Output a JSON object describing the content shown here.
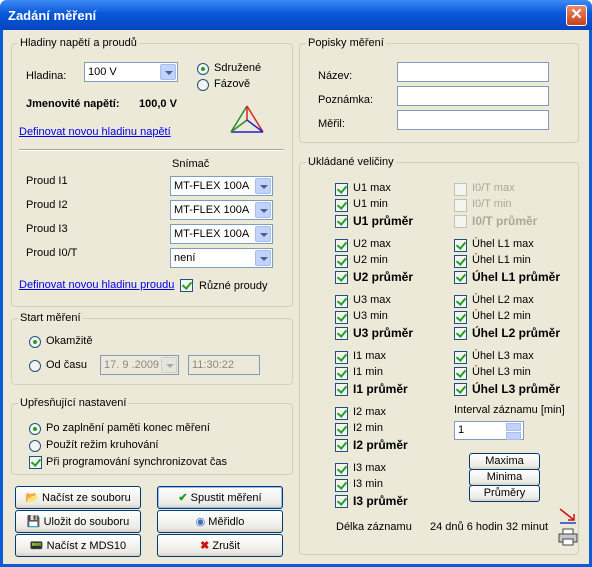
{
  "window": {
    "title": "Zadání měření",
    "close": "✕"
  },
  "levels": {
    "legend": "Hladiny napětí a proudů",
    "hladina_label": "Hladina:",
    "hladina_value": "100 V",
    "radio1": "Sdružené",
    "radio2": "Fázově",
    "nominal_label": "Jmenovité napětí:",
    "nominal_value": "100,0 V",
    "link_voltage": "Definovat novou hladinu napětí",
    "snimac": "Snímač",
    "currents": [
      {
        "label": "Proud I1",
        "value": "MT-FLEX 100A"
      },
      {
        "label": "Proud I2",
        "value": "MT-FLEX 100A"
      },
      {
        "label": "Proud I3",
        "value": "MT-FLEX 100A"
      },
      {
        "label": "Proud I0/T",
        "value": "není"
      }
    ],
    "link_current": "Definovat novou hladinu proudu",
    "ruzne": "Různé proudy"
  },
  "start": {
    "legend": "Start měření",
    "okamzite": "Okamžitě",
    "od_casu": "Od času",
    "date": "17. 9 .2009",
    "time": "11:30:22"
  },
  "refine": {
    "legend": "Upřesňující nastavení",
    "opt1": "Po zaplnění paměti konec měření",
    "opt2": "Použít režim kruhování",
    "opt3": "Při programování synchronizovat čas"
  },
  "buttons": {
    "load_file": "Načíst ze souboru",
    "save_file": "Uložit do souboru",
    "load_mds": "Načíst z MDS10",
    "start": "Spustit měření",
    "meter": "Měřidlo",
    "cancel": "Zrušit"
  },
  "descr": {
    "legend": "Popisky měření",
    "name": "Název:",
    "note": "Poznámka:",
    "measured_by": "Měřil:"
  },
  "stored": {
    "legend": "Ukládané veličiny",
    "left": [
      [
        "U1 max",
        "U1 min",
        "U1 průměr"
      ],
      [
        "U2 max",
        "U2 min",
        "U2 průměr"
      ],
      [
        "U3 max",
        "U3 min",
        "U3 průměr"
      ],
      [
        "I1 max",
        "I1 min",
        "I1 průměr"
      ],
      [
        "I2 max",
        "I2 min",
        "I2 průměr"
      ],
      [
        "I3 max",
        "I3 min",
        "I3 průměr"
      ]
    ],
    "right": [
      [
        "I0/T max",
        "I0/T min",
        "I0/T průměr"
      ],
      [
        "Úhel L1 max",
        "Úhel L1 min",
        "Úhel L1 průměr"
      ],
      [
        "Úhel L2 max",
        "Úhel L2 min",
        "Úhel L2 průměr"
      ],
      [
        "Úhel L3 max",
        "Úhel L3 min",
        "Úhel L3 průměr"
      ]
    ],
    "interval_label": "Interval záznamu [min]",
    "interval_value": "1",
    "maxima": "Maxima",
    "minima": "Minima",
    "prumery": "Průměry",
    "delka_label": "Délka záznamu",
    "delka_value": "24 dnů 6 hodin 32 minut"
  }
}
